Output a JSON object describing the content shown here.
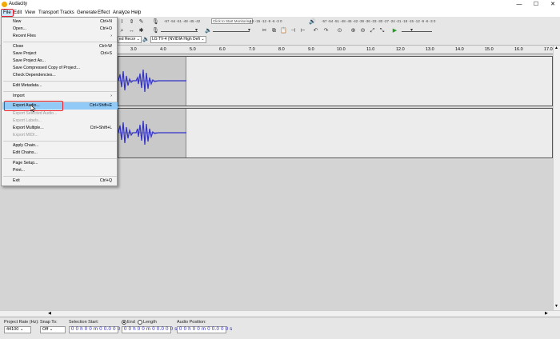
{
  "window": {
    "title": "Audacity",
    "minimize": "—",
    "maximize": "☐",
    "close": "✕"
  },
  "menubar": [
    "File",
    "Edit",
    "View",
    "Transport",
    "Tracks",
    "Generate",
    "Effect",
    "Analyze",
    "Help"
  ],
  "toolbar": {
    "meter_scale": "-57 -54 -51 -48 -45 -42",
    "meter_scale_end": "-18 -15 -12 -9 -6 -3 0",
    "monitor_hint": "Click to Start Monitoring",
    "playback_scale": "-57 -54 -51 -48 -45 -42 -39 -36 -33 -30 -27 -24 -21 -18 -15 -12 -9 -6 -3 0",
    "recording_device_fragment": "ed Recor",
    "playback_device": "LG TV-4 (NVIDIA High Defi"
  },
  "ruler": {
    "ticks": [
      "3.0",
      "4.0",
      "5.0",
      "6.0",
      "7.0",
      "8.0",
      "9.0",
      "10.0",
      "11.0",
      "12.0",
      "13.0",
      "14.0",
      "15.0",
      "16.0",
      "17.0"
    ]
  },
  "file_menu": {
    "items": [
      {
        "label": "New",
        "shortcut": "Ctrl+N",
        "disabled": false
      },
      {
        "label": "Open...",
        "shortcut": "Ctrl+O",
        "disabled": false
      },
      {
        "label": "Recent Files",
        "shortcut": "›",
        "disabled": false
      },
      {
        "label": "Close",
        "shortcut": "Ctrl+W",
        "disabled": false
      },
      {
        "label": "Save Project",
        "shortcut": "Ctrl+S",
        "disabled": false
      },
      {
        "label": "Save Project As...",
        "shortcut": "",
        "disabled": false
      },
      {
        "label": "Save Compressed Copy of Project...",
        "shortcut": "",
        "disabled": false
      },
      {
        "label": "Check Dependencies...",
        "shortcut": "",
        "disabled": false
      },
      {
        "label": "Edit Metadata...",
        "shortcut": "",
        "disabled": false
      },
      {
        "label": "Import",
        "shortcut": "›",
        "disabled": false
      },
      {
        "label": "Export Audio...",
        "shortcut": "Ctrl+Shift+E",
        "disabled": false
      },
      {
        "label": "Export Selected Audio...",
        "shortcut": "",
        "disabled": true
      },
      {
        "label": "Export Labels...",
        "shortcut": "",
        "disabled": true
      },
      {
        "label": "Export Multiple...",
        "shortcut": "Ctrl+Shift+L",
        "disabled": false
      },
      {
        "label": "Export MIDI...",
        "shortcut": "",
        "disabled": true
      },
      {
        "label": "Apply Chain...",
        "shortcut": "",
        "disabled": false
      },
      {
        "label": "Edit Chains...",
        "shortcut": "",
        "disabled": false
      },
      {
        "label": "Page Setup...",
        "shortcut": "",
        "disabled": false
      },
      {
        "label": "Print...",
        "shortcut": "",
        "disabled": false
      },
      {
        "label": "Exit",
        "shortcut": "Ctrl+Q",
        "disabled": false
      }
    ]
  },
  "selection_bar": {
    "project_rate_label": "Project Rate (Hz):",
    "project_rate_value": "44100",
    "snap_to_label": "Snap To:",
    "snap_to_value": "Off",
    "selection_start_label": "Selection Start:",
    "selection_start_value": "0 0 h 0 0 m 0 0.0 0 0 s",
    "end_label": "End",
    "length_label": "Length",
    "end_value": "0 0 h 0 0 m 0 0.0 0 0 s",
    "audio_position_label": "Audio Position:",
    "audio_position_value": "0 0 h 0 0 m 0 0.0 0 0 s"
  },
  "colors": {
    "waveform": "#3232c8",
    "highlight": "#91c9f7",
    "annotation_red": "#e8202a"
  }
}
